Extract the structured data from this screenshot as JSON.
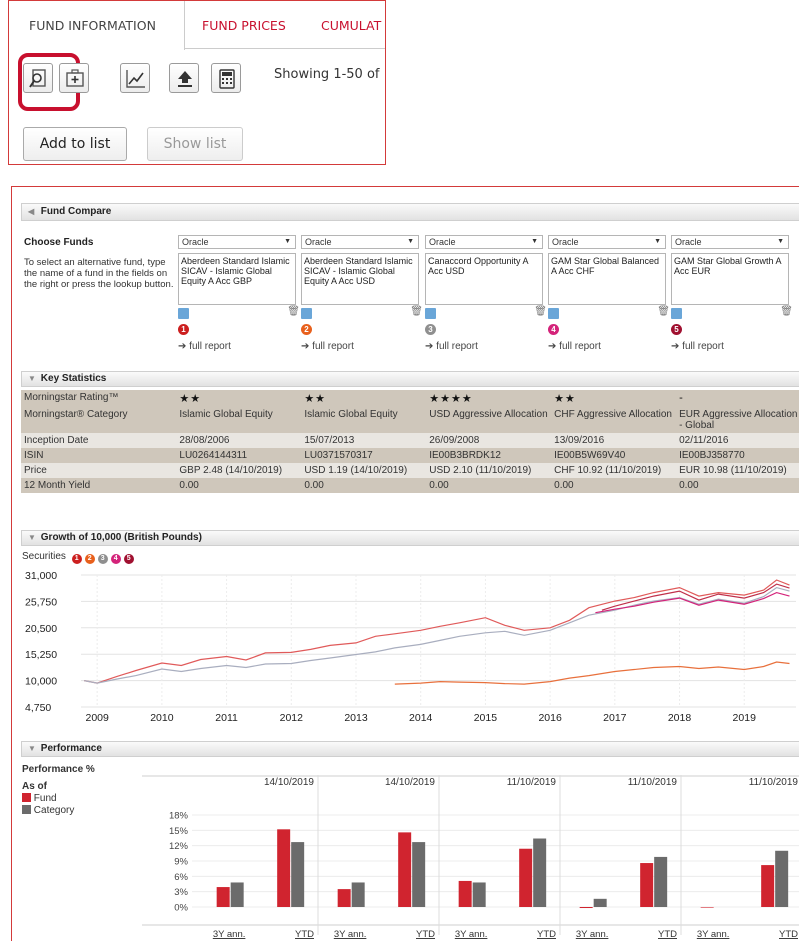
{
  "tabs": [
    {
      "label": "FUND INFORMATION",
      "active": true
    },
    {
      "label": "FUND PRICES",
      "active": false
    },
    {
      "label": "CUMULAT",
      "active": false
    }
  ],
  "toolbar": {
    "icons": [
      "fund-lookup-icon",
      "portfolio-add-icon",
      "chart-icon",
      "export-icon",
      "calculator-icon"
    ],
    "showing_text": "Showing 1-50 of",
    "add_to_list": "Add to list",
    "show_list": "Show list"
  },
  "compare": {
    "title": "Fund Compare",
    "choose_label": "Choose Funds",
    "help_text": "To select an alternative fund, type the name of a fund in the fields on the right or press the lookup button.",
    "funds": [
      {
        "source": "Oracle",
        "name": "Aberdeen Standard Islamic SICAV - Islamic Global Equity A Acc GBP",
        "number": "1",
        "color": "#cc1f1f",
        "full_report": "full report"
      },
      {
        "source": "Oracle",
        "name": "Aberdeen Standard Islamic SICAV - Islamic Global Equity A Acc USD",
        "number": "2",
        "color": "#e8601c",
        "full_report": "full report"
      },
      {
        "source": "Oracle",
        "name": "Canaccord Opportunity A Acc USD",
        "number": "3",
        "color": "#8f8f8f",
        "full_report": "full report"
      },
      {
        "source": "Oracle",
        "name": "GAM Star Global Balanced A Acc CHF",
        "number": "4",
        "color": "#d4237a",
        "full_report": "full report"
      },
      {
        "source": "Oracle",
        "name": "GAM Star Global Growth A Acc EUR",
        "number": "5",
        "color": "#a01030",
        "full_report": "full report"
      }
    ]
  },
  "key_statistics": {
    "title": "Key Statistics",
    "rows": [
      {
        "label": "Morningstar Rating™",
        "values": [
          "★★",
          "★★",
          "★★★★",
          "★★",
          "-"
        ],
        "star": true
      },
      {
        "label": "Morningstar® Category",
        "values": [
          "Islamic Global Equity",
          "Islamic Global Equity",
          "USD Aggressive Allocation",
          "CHF Aggressive Allocation",
          "EUR Aggressive Allocation - Global"
        ]
      },
      {
        "label": "Inception Date",
        "values": [
          "28/08/2006",
          "15/07/2013",
          "26/09/2008",
          "13/09/2016",
          "02/11/2016"
        ]
      },
      {
        "label": "ISIN",
        "values": [
          "LU0264144311",
          "LU0371570317",
          "IE00B3BRDK12",
          "IE00B5W69V40",
          "IE00BJ358770"
        ]
      },
      {
        "label": "Price",
        "values": [
          "GBP 2.48 (14/10/2019)",
          "USD 1.19 (14/10/2019)",
          "USD 2.10 (11/10/2019)",
          "CHF 10.92 (11/10/2019)",
          "EUR 10.98 (11/10/2019)"
        ]
      },
      {
        "label": "12 Month Yield",
        "values": [
          "0.00",
          "0.00",
          "0.00",
          "0.00",
          "0.00"
        ]
      }
    ]
  },
  "growth": {
    "title": "Growth of 10,000 (British Pounds)",
    "securities_label": "Securities",
    "chart_data": {
      "type": "line",
      "title": "Growth of 10,000 (British Pounds)",
      "x_ticks": [
        "2009",
        "2010",
        "2011",
        "2012",
        "2013",
        "2014",
        "2015",
        "2016",
        "2017",
        "2018",
        "2019"
      ],
      "y_ticks": [
        "31,000",
        "25,750",
        "20,500",
        "15,250",
        "10,000",
        "4,750"
      ],
      "ylim": [
        4750,
        31000
      ],
      "xlim": [
        2008.75,
        2019.8
      ],
      "grid": true,
      "series": [
        {
          "name": "1",
          "color": "#e05a5a",
          "x": [
            2008.8,
            2009.0,
            2009.3,
            2009.6,
            2010.0,
            2010.3,
            2010.6,
            2011.0,
            2011.3,
            2011.6,
            2012.0,
            2012.3,
            2012.6,
            2013.0,
            2013.3,
            2013.6,
            2014.0,
            2014.3,
            2014.6,
            2015.0,
            2015.3,
            2015.6,
            2016.0,
            2016.3,
            2016.6,
            2017.0,
            2017.3,
            2017.6,
            2018.0,
            2018.3,
            2018.6,
            2019.0,
            2019.3,
            2019.5,
            2019.7
          ],
          "y": [
            10000,
            9500,
            10800,
            12000,
            13500,
            13000,
            14200,
            14800,
            14100,
            15500,
            15600,
            16200,
            17000,
            17500,
            18800,
            19300,
            20000,
            20800,
            21500,
            22500,
            21000,
            20000,
            20500,
            22000,
            24500,
            25800,
            26500,
            27500,
            28500,
            26800,
            27500,
            27000,
            28000,
            30000,
            29000
          ]
        },
        {
          "name": "2",
          "color": "#e8703c",
          "x": [
            2013.6,
            2014.0,
            2014.3,
            2014.6,
            2015.0,
            2015.3,
            2015.6,
            2016.0,
            2016.3,
            2016.6,
            2017.0,
            2017.3,
            2017.6,
            2018.0,
            2018.3,
            2018.6,
            2019.0,
            2019.3,
            2019.5,
            2019.7
          ],
          "y": [
            9300,
            9500,
            9800,
            9700,
            9600,
            9400,
            9300,
            9800,
            10500,
            11000,
            11800,
            12200,
            12600,
            12800,
            12400,
            12700,
            12200,
            12800,
            13700,
            13400
          ]
        },
        {
          "name": "3",
          "color": "#a9aebf",
          "x": [
            2008.8,
            2009.0,
            2009.3,
            2009.6,
            2010.0,
            2010.3,
            2010.6,
            2011.0,
            2011.3,
            2011.6,
            2012.0,
            2012.3,
            2012.6,
            2013.0,
            2013.3,
            2013.6,
            2014.0,
            2014.3,
            2014.6,
            2015.0,
            2015.3,
            2015.6,
            2016.0,
            2016.3,
            2016.6,
            2017.0,
            2017.3,
            2017.6,
            2018.0,
            2018.3,
            2018.6,
            2019.0,
            2019.3,
            2019.5,
            2019.7
          ],
          "y": [
            10000,
            9500,
            10300,
            11000,
            12300,
            11800,
            12400,
            13000,
            12600,
            13300,
            13400,
            14000,
            14500,
            15200,
            15700,
            16500,
            17200,
            18000,
            18800,
            19500,
            19800,
            19000,
            20000,
            21500,
            23000,
            24000,
            25000,
            25800,
            26500,
            25200,
            26200,
            25400,
            26700,
            28500,
            27800
          ]
        },
        {
          "name": "4",
          "color": "#d4237a",
          "x": [
            2016.7,
            2017.0,
            2017.3,
            2017.6,
            2018.0,
            2018.3,
            2018.6,
            2019.0,
            2019.3,
            2019.5,
            2019.7
          ],
          "y": [
            23500,
            24200,
            24800,
            25600,
            26400,
            25000,
            26000,
            25200,
            26300,
            27500,
            26800
          ]
        },
        {
          "name": "5",
          "color": "#c0304a",
          "x": [
            2016.8,
            2017.0,
            2017.3,
            2017.6,
            2018.0,
            2018.3,
            2018.6,
            2019.0,
            2019.3,
            2019.5,
            2019.7
          ],
          "y": [
            24000,
            24800,
            25800,
            26800,
            27800,
            26000,
            27200,
            26400,
            27500,
            29200,
            28400
          ]
        }
      ]
    }
  },
  "performance": {
    "title": "Performance",
    "subtitle": "Performance %",
    "as_of_label": "As of",
    "chart_data": {
      "type": "bar",
      "title": "Performance %",
      "y_ticks": [
        "18%",
        "15%",
        "12%",
        "9%",
        "6%",
        "3%",
        "0%"
      ],
      "ylim": [
        0,
        18
      ],
      "grid": true,
      "legend": [
        "Fund",
        "Category"
      ],
      "colors": [
        "#d0242f",
        "#6b6b6b"
      ],
      "groups": [
        {
          "as_of": "14/10/2019",
          "categories": [
            "3Y ann.",
            "YTD"
          ],
          "fund": [
            3.9,
            15.2
          ],
          "category": [
            4.8,
            12.7
          ]
        },
        {
          "as_of": "14/10/2019",
          "categories": [
            "3Y ann.",
            "YTD"
          ],
          "fund": [
            3.5,
            14.6
          ],
          "category": [
            4.8,
            12.7
          ]
        },
        {
          "as_of": "11/10/2019",
          "categories": [
            "3Y ann.",
            "YTD"
          ],
          "fund": [
            5.1,
            11.4
          ],
          "category": [
            4.8,
            13.4
          ]
        },
        {
          "as_of": "11/10/2019",
          "categories": [
            "3Y ann.",
            "YTD"
          ],
          "fund": [
            -0.2,
            8.6
          ],
          "category": [
            1.6,
            9.8
          ]
        },
        {
          "as_of": "11/10/2019",
          "categories": [
            "3Y ann.",
            "YTD"
          ],
          "fund": [
            0,
            8.2
          ],
          "category": [
            0,
            11.0
          ]
        }
      ]
    }
  }
}
